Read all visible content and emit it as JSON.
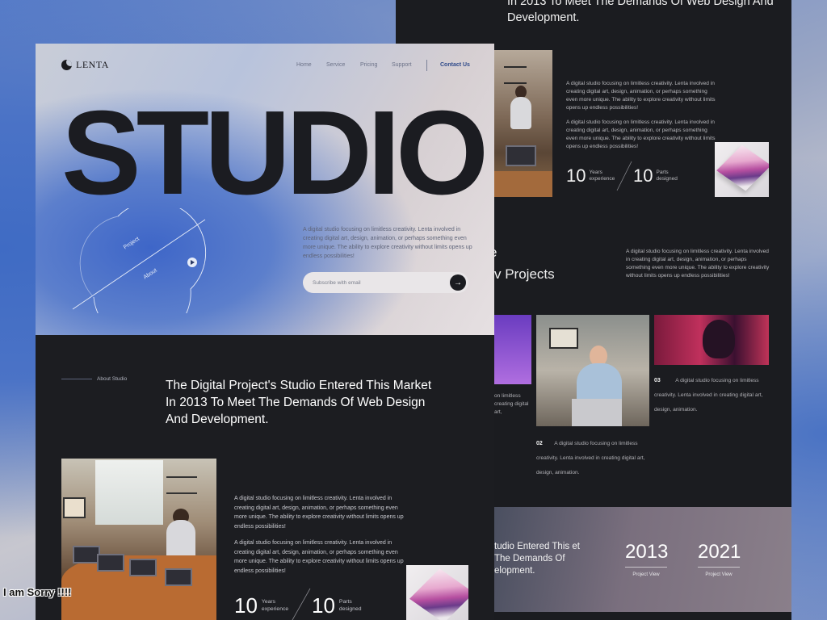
{
  "brand": {
    "name": "LENTA"
  },
  "nav": {
    "items": [
      "Home",
      "Service",
      "Pricing",
      "Support"
    ],
    "contact": "Contact Us"
  },
  "hero": {
    "title": "STUDIO",
    "circle_label_1": "Project",
    "circle_label_2": "About",
    "description": "A digital studio focusing on limitless creativity. Lenta involved in creating digital art, design, animation, or perhaps something even more unique. The ability to explore creativity without limits opens up endless possibilities!",
    "subscribe_placeholder": "Subscribe with email",
    "subscribe_icon": "arrow-right-icon"
  },
  "about": {
    "label": "About Studio",
    "title": "The Digital Project's Studio Entered This Market In 2013 To Meet The Demands Of Web Design And Development.",
    "paragraph_1": "A digital studio focusing on limitless creativity. Lenta involved in creating digital art, design, animation, or perhaps something even more unique. The ability to explore creativity without limits opens up endless possibilities!",
    "paragraph_2": "A digital studio focusing on limitless creativity. Lenta involved in creating digital art, design, animation, or perhaps something even more unique. The ability to explore creativity without limits opens up endless possibilities!",
    "stats": [
      {
        "value": "10",
        "label": "Years experience"
      },
      {
        "value": "10",
        "label": "Parts designed"
      }
    ]
  },
  "back": {
    "top_title": "In 2013 To Meet The Demands Of Web Design And Development.",
    "paragraph_1": "A digital studio focusing on limitless creativity. Lenta involved in creating digital art, design, animation, or perhaps something even more unique. The ability to explore creativity without limits opens up endless possibilities!",
    "paragraph_2": "A digital studio focusing on limitless creativity. Lenta involved in creating digital art, design, animation, or perhaps something even more unique. The ability to explore creativity without limits opens up endless possibilities!",
    "stats": [
      {
        "value": "10",
        "label": "Years experience"
      },
      {
        "value": "10",
        "label": "Parts designed"
      }
    ],
    "projects_letter": "e",
    "projects_heading": "v Projects",
    "projects_desc": "A digital studio focusing on limitless creativity. Lenta involved in creating digital art, design, animation, or perhaps something even more unique. The ability to explore creativity without limits opens up endless possibilities!",
    "project_left_text": "on limitless creating digital art,",
    "project_02": {
      "num": "02",
      "text": "A digital studio focusing on limitless creativity. Lenta involved in creating digital art, design, animation."
    },
    "project_03": {
      "num": "03",
      "text": "A digital studio focusing on limitless creativity. Lenta involved in creating digital art, design, animation."
    },
    "band_text": "tudio Entered This et The Demands Of elopment.",
    "years": [
      {
        "year": "2013",
        "label": "Project View"
      },
      {
        "year": "2021",
        "label": "Project View"
      }
    ]
  },
  "overlay_text": "I am Sorry !!!!"
}
